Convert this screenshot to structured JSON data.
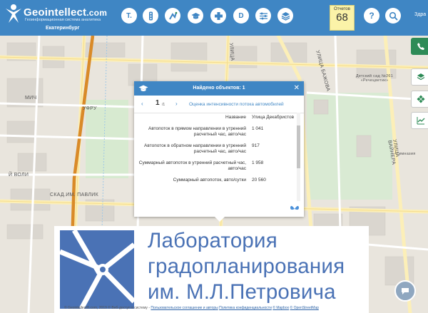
{
  "header": {
    "brand": "Geointellect",
    "brand_suffix": ".com",
    "tagline": "Геоинформационная система аналитика",
    "city": "Екатеринбург",
    "user_fragment": "Здра",
    "reports": {
      "label": "Отчетов",
      "count": "68"
    },
    "tools": [
      {
        "label": "T.",
        "icon": "text-tool-icon"
      },
      {
        "label": "",
        "icon": "traffic-light-icon"
      },
      {
        "label": "",
        "icon": "layers-transform-icon"
      },
      {
        "label": "",
        "icon": "graduation-cap-icon"
      },
      {
        "label": "",
        "icon": "medical-cross-icon"
      },
      {
        "label": "D",
        "icon": "d-letter-icon"
      },
      {
        "label": "",
        "icon": "sliders-icon"
      },
      {
        "label": "",
        "icon": "layers-icon"
      },
      {
        "label": "?",
        "icon": "help-icon"
      },
      {
        "label": "",
        "icon": "search-icon"
      }
    ]
  },
  "map": {
    "labels": {
      "ufa": "УФРУ",
      "bazhova": "УЛИЦА БАЖОВА",
      "pushkin": "УЛИЦА",
      "mich": "МИЧ",
      "volny": "Й ВОЛИ",
      "pavlik": "СКАД.ИМ. ПАВЛИК",
      "vainera": "УЛИЦА ВАЙНЕРА",
      "kindergarten": "Детский сад №261 «Речецветик»",
      "gymnasium": "Гимназия"
    }
  },
  "popup": {
    "title": "Найдено объектов: 1",
    "page": "1",
    "pages": "/1",
    "object_name": "Оценка интенсивности потока автомобилей",
    "rows": [
      {
        "key": "Название",
        "value": "Улица Декабристов"
      },
      {
        "key": "Автопоток в прямом направлении в утренний расчетный час, авто/час",
        "value": "1 041"
      },
      {
        "key": "Автопоток в обратном направлении в утренний расчетный час, авто/час",
        "value": "917"
      },
      {
        "key": "Суммарный автопоток в утренний расчетный час, авто/час",
        "value": "1 958"
      },
      {
        "key": "Суммарный автопоток, авто/сутки",
        "value": "20 560"
      }
    ]
  },
  "banner": {
    "line1": "Лаборатория",
    "line2": "градопланирования",
    "line3": "им. М.Л.Петровича"
  },
  "footer": {
    "copyright": "© Geointellect®.com, 2019 © Веб-доступ в систему -",
    "terms": "Пользовательское соглашение и авторы",
    "privacy": "Политика конфиденциальности",
    "mapbox": "© Mapbox",
    "osm": "© OpenStreetMap"
  },
  "colors": {
    "header": "#3f86c4",
    "accent": "#3f86c4",
    "sidebar_green": "#2e8b57",
    "reports_bg": "#fbf3a8",
    "banner_text": "#4a72b5"
  }
}
